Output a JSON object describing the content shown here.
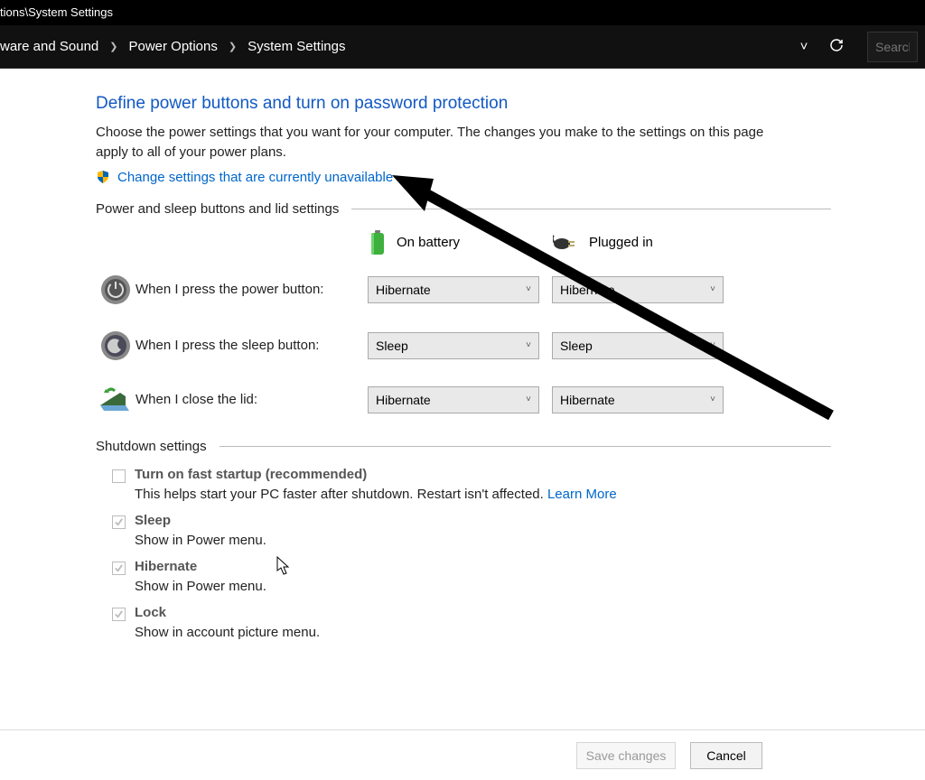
{
  "window": {
    "title_suffix": "tions\\System Settings"
  },
  "breadcrumb": {
    "item1": "ware and Sound",
    "item2": "Power Options",
    "item3": "System Settings"
  },
  "search": {
    "placeholder": "Search"
  },
  "page": {
    "heading": "Define power buttons and turn on password protection",
    "intro": "Choose the power settings that you want for your computer. The changes you make to the settings on this page apply to all of your power plans.",
    "change_link": "Change settings that are currently unavailable"
  },
  "sections": {
    "buttons_lid": "Power and sleep buttons and lid settings",
    "shutdown": "Shutdown settings"
  },
  "columns": {
    "battery": "On battery",
    "plugged": "Plugged in"
  },
  "rows": {
    "power_button": {
      "label": "When I press the power button:",
      "battery": "Hibernate",
      "plugged": "Hibernate"
    },
    "sleep_button": {
      "label": "When I press the sleep button:",
      "battery": "Sleep",
      "plugged": "Sleep"
    },
    "lid": {
      "label": "When I close the lid:",
      "battery": "Hibernate",
      "plugged": "Hibernate"
    }
  },
  "shutdown": {
    "fast_startup": {
      "label": "Turn on fast startup (recommended)",
      "desc_pre": "This helps start your PC faster after shutdown. Restart isn't affected. ",
      "learn_more": "Learn More"
    },
    "sleep": {
      "label": "Sleep",
      "desc": "Show in Power menu."
    },
    "hibernate": {
      "label": "Hibernate",
      "desc": "Show in Power menu."
    },
    "lock": {
      "label": "Lock",
      "desc": "Show in account picture menu."
    }
  },
  "footer": {
    "save": "Save changes",
    "cancel": "Cancel"
  }
}
